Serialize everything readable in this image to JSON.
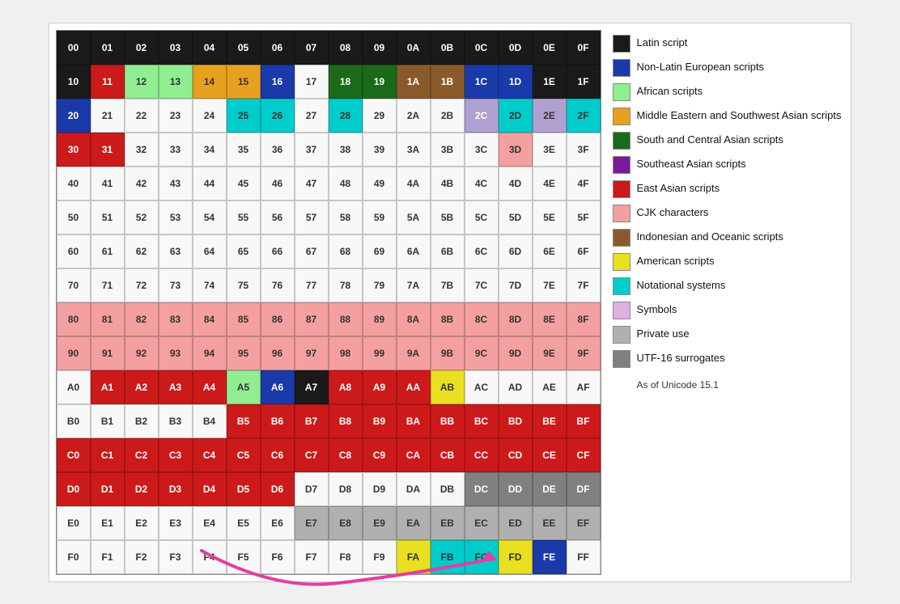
{
  "legend": {
    "items": [
      {
        "label": "Latin script",
        "color": "#1a1a1a",
        "id": "latin"
      },
      {
        "label": "Non-Latin European scripts",
        "color": "#1a3aaa",
        "id": "non-latin-european"
      },
      {
        "label": "African scripts",
        "color": "#90ee90",
        "id": "african"
      },
      {
        "label": "Middle Eastern and Southwest Asian scripts",
        "color": "#e8a020",
        "id": "middle-eastern"
      },
      {
        "label": "South and Central Asian scripts",
        "color": "#1a6a1a",
        "id": "south-central-asian"
      },
      {
        "label": "Southeast Asian scripts",
        "color": "#7a1a9a",
        "id": "southeast-asian"
      },
      {
        "label": "East Asian scripts",
        "color": "#cc1a1a",
        "id": "east-asian"
      },
      {
        "label": "CJK characters",
        "color": "#f4a0a0",
        "id": "cjk"
      },
      {
        "label": "Indonesian and Oceanic scripts",
        "color": "#8b5a2b",
        "id": "indonesian-oceanic"
      },
      {
        "label": "American scripts",
        "color": "#e8e020",
        "id": "american"
      },
      {
        "label": "Notational systems",
        "color": "#00cccc",
        "id": "notational"
      },
      {
        "label": "Symbols",
        "color": "#e0b0e0",
        "id": "symbols"
      },
      {
        "label": "Private use",
        "color": "#b0b0b0",
        "id": "private-use"
      },
      {
        "label": "UTF-16 surrogates",
        "color": "#808080",
        "id": "utf16-surrogates"
      }
    ],
    "note": "As of Unicode 15.1"
  },
  "grid": {
    "rows": [
      [
        "00",
        "01",
        "02",
        "03",
        "04",
        "05",
        "06",
        "07",
        "08",
        "09",
        "0A",
        "0B",
        "0C",
        "0D",
        "0E",
        "0F"
      ],
      [
        "10",
        "11",
        "12",
        "13",
        "14",
        "15",
        "16",
        "17",
        "18",
        "19",
        "1A",
        "1B",
        "1C",
        "1D",
        "1E",
        "1F"
      ],
      [
        "20",
        "21",
        "22",
        "23",
        "24",
        "25",
        "26",
        "27",
        "28",
        "29",
        "2A",
        "2B",
        "2C",
        "2D",
        "2E",
        "2F"
      ],
      [
        "30",
        "31",
        "32",
        "33",
        "34",
        "35",
        "36",
        "37",
        "38",
        "39",
        "3A",
        "3B",
        "3C",
        "3D",
        "3E",
        "3F"
      ],
      [
        "40",
        "41",
        "42",
        "43",
        "44",
        "45",
        "46",
        "47",
        "48",
        "49",
        "4A",
        "4B",
        "4C",
        "4D",
        "4E",
        "4F"
      ],
      [
        "50",
        "51",
        "52",
        "53",
        "54",
        "55",
        "56",
        "57",
        "58",
        "59",
        "5A",
        "5B",
        "5C",
        "5D",
        "5E",
        "5F"
      ],
      [
        "60",
        "61",
        "62",
        "63",
        "64",
        "65",
        "66",
        "67",
        "68",
        "69",
        "6A",
        "6B",
        "6C",
        "6D",
        "6E",
        "6F"
      ],
      [
        "70",
        "71",
        "72",
        "73",
        "74",
        "75",
        "76",
        "77",
        "78",
        "79",
        "7A",
        "7B",
        "7C",
        "7D",
        "7E",
        "7F"
      ],
      [
        "80",
        "81",
        "82",
        "83",
        "84",
        "85",
        "86",
        "87",
        "88",
        "89",
        "8A",
        "8B",
        "8C",
        "8D",
        "8E",
        "8F"
      ],
      [
        "90",
        "91",
        "92",
        "93",
        "94",
        "95",
        "96",
        "97",
        "98",
        "99",
        "9A",
        "9B",
        "9C",
        "9D",
        "9E",
        "9F"
      ],
      [
        "A0",
        "A1",
        "A2",
        "A3",
        "A4",
        "A5",
        "A6",
        "A7",
        "A8",
        "A9",
        "AA",
        "AB",
        "AC",
        "AD",
        "AE",
        "AF"
      ],
      [
        "B0",
        "B1",
        "B2",
        "B3",
        "B4",
        "B5",
        "B6",
        "B7",
        "B8",
        "B9",
        "BA",
        "BB",
        "BC",
        "BD",
        "BE",
        "BF"
      ],
      [
        "C0",
        "C1",
        "C2",
        "C3",
        "C4",
        "C5",
        "C6",
        "C7",
        "C8",
        "C9",
        "CA",
        "CB",
        "CC",
        "CD",
        "CE",
        "CF"
      ],
      [
        "D0",
        "D1",
        "D2",
        "D3",
        "D4",
        "D5",
        "D6",
        "D7",
        "D8",
        "D9",
        "DA",
        "DB",
        "DC",
        "DD",
        "DE",
        "DF"
      ],
      [
        "E0",
        "E1",
        "E2",
        "E3",
        "E4",
        "E5",
        "E6",
        "E7",
        "E8",
        "E9",
        "EA",
        "EB",
        "EC",
        "ED",
        "EE",
        "EF"
      ],
      [
        "F0",
        "F1",
        "F2",
        "F3",
        "F4",
        "F5",
        "F6",
        "F7",
        "F8",
        "F9",
        "FA",
        "FB",
        "FC",
        "FD",
        "FE",
        "FF"
      ]
    ]
  }
}
